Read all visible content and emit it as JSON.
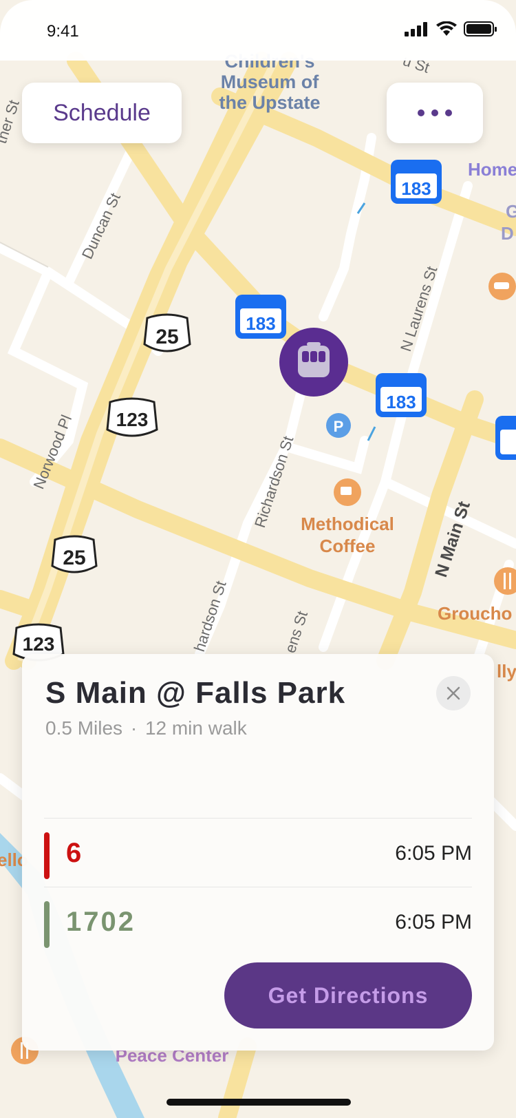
{
  "status_bar": {
    "time": "9:41"
  },
  "buttons": {
    "schedule": "Schedule",
    "more_icon": "more-dots-icon"
  },
  "map": {
    "labels": {
      "museum": [
        "Children's",
        "Museum of",
        "the Upstate"
      ],
      "coffee": [
        "Methodical",
        "Coffee"
      ],
      "peace_center": "Peace Center",
      "streets": {
        "duncan": "Duncan St",
        "norwood": "Norwood Pl",
        "richardson": "Richardson St",
        "richardson_lower": "hardson St",
        "n_laurens": "N Laurens St",
        "n_main": "N Main St",
        "laurens_lower": "ens St",
        "top_right": "u St",
        "top_left": "ther St"
      },
      "poi_right": [
        "Home",
        "G",
        "D",
        "Groucho",
        "lly'"
      ],
      "left_edge": "ello"
    },
    "shields": {
      "us25": "25",
      "us123": "123",
      "sc183": "183"
    },
    "parking": "P"
  },
  "stop_card": {
    "title": "S Main @ Falls Park",
    "distance": "0.5 Miles",
    "separator": "·",
    "walk": "12 min walk",
    "close_icon": "close-icon",
    "routes": [
      {
        "name": "6",
        "time": "6:05 PM",
        "color": "#cc1111"
      },
      {
        "name": "1702",
        "time": "6:05 PM",
        "color": "#7a9470"
      }
    ],
    "directions_label": "Get Directions"
  },
  "colors": {
    "brand": "#5b3786",
    "accent_text": "#c59ce8"
  }
}
